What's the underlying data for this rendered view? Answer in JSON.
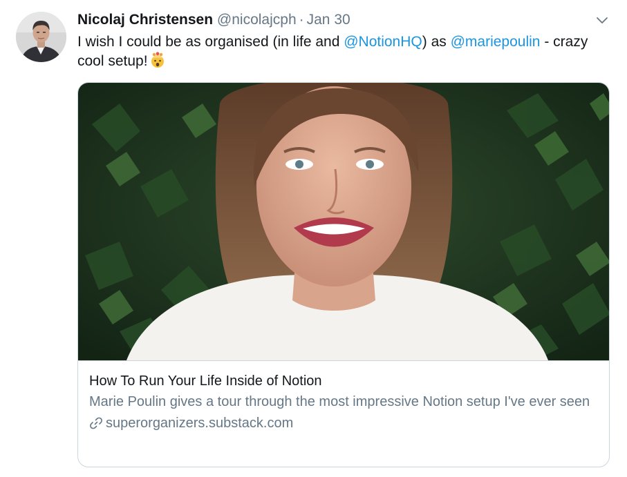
{
  "tweet": {
    "author_name": "Nicolaj Christensen",
    "author_handle": "@nicolajcph",
    "separator": "·",
    "date": "Jan 30",
    "text_part1": "I wish I could be as organised (in life and ",
    "mention1": "@NotionHQ",
    "text_part2": ") as ",
    "mention2": "@mariepoulin",
    "text_part3": " - crazy cool setup!",
    "emoji": "exploding-head-emoji"
  },
  "card": {
    "title": "How To Run Your Life Inside of Notion",
    "description": "Marie Poulin gives a tour through the most impressive Notion setup I've ever seen",
    "domain": "superorganizers.substack.com"
  },
  "icons": {
    "caret": "chevron-down-icon",
    "link": "link-icon"
  },
  "colors": {
    "mention": "#1b95e0",
    "secondary_text": "#657786",
    "border": "#ccd6dd"
  }
}
